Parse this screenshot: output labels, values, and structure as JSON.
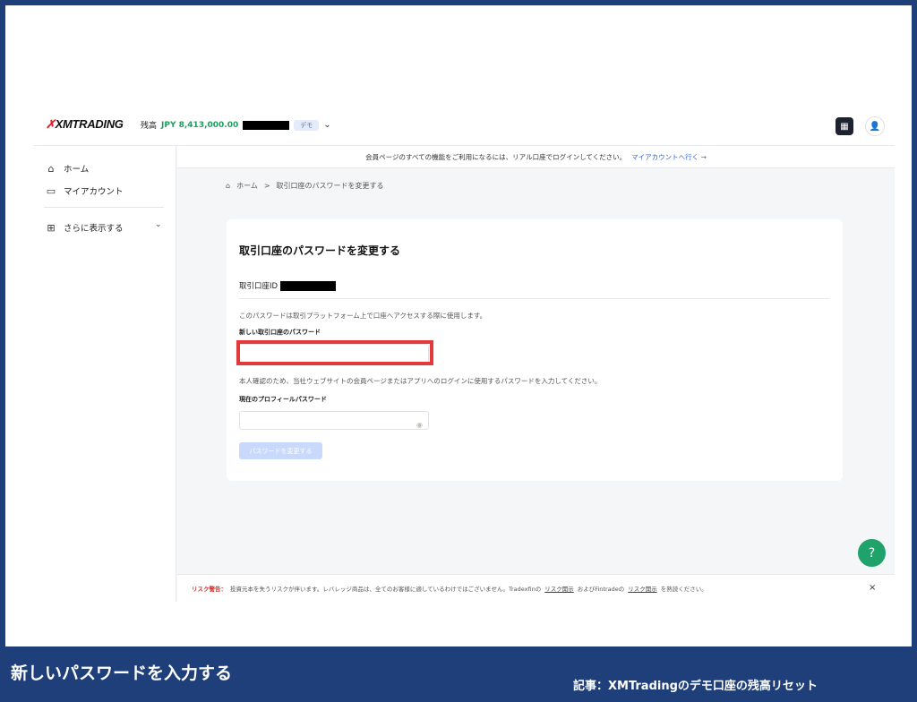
{
  "header": {
    "logo": "XMTRADING",
    "balance_label": "残高",
    "balance_amount": "JPY 8,413,000.00",
    "demo_badge": "デモ",
    "chevron": "⌄"
  },
  "sidebar": {
    "items": [
      {
        "label": "ホーム",
        "icon": "home-icon"
      },
      {
        "label": "マイアカウント",
        "icon": "card-icon"
      },
      {
        "label": "さらに表示する",
        "icon": "grid-icon"
      }
    ]
  },
  "notice": {
    "text": "会員ページのすべての機能をご利用になるには、リアル口座でログインしてください。",
    "link": "マイアカウントへ行く →"
  },
  "breadcrumb": {
    "home": "ホーム",
    "separator": ">",
    "current": "取引口座のパスワードを変更する"
  },
  "form": {
    "title": "取引口座のパスワードを変更する",
    "account_id_label": "取引口座ID",
    "description": "このパスワードは取引プラットフォーム上で口座へアクセスする際に使用します。",
    "new_password_label": "新しい取引口座のパスワード",
    "new_password_value": "",
    "verify_description": "本人確認のため、当社ウェブサイトの会員ページまたはアプリへのログインに使用するパスワードを入力してください。",
    "current_password_label": "現在のプロフィールパスワード",
    "current_password_value": "",
    "submit_label": "パスワードを変更する"
  },
  "risk": {
    "warning_label": "リスク警告：",
    "text_1": "投資元本を失うリスクが伴います。レバレッジ商品は、全てのお客様に適しているわけではございません。Tradexfinの",
    "link_1": "リスク開示",
    "text_2": "およびFintradeの",
    "link_2": "リスク開示",
    "text_3": "を熟読ください。",
    "close": "×"
  },
  "caption": {
    "main": "新しいパスワードを入力する",
    "article": "記事：XMTradingのデモ口座の残高リセット"
  },
  "colors": {
    "accent_green": "#1f9d62",
    "link_blue": "#2b63d8",
    "highlight_red": "#e23a3a",
    "page_bg": "#1f3f7a"
  }
}
